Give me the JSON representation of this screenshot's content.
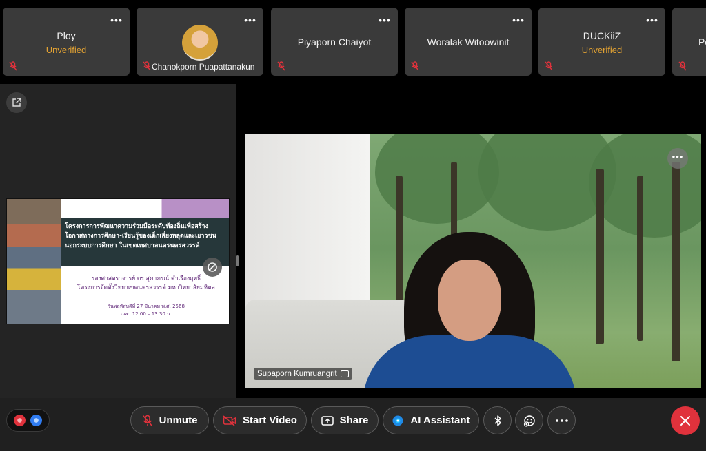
{
  "participants": [
    {
      "name": "Ploy",
      "status": "Unverified"
    },
    {
      "name": "Chanokporn Puapattanakun"
    },
    {
      "name": "Piyaporn Chaiyot"
    },
    {
      "name": "Woralak Witoowinit"
    },
    {
      "name": "DUCKiiZ",
      "status": "Unverified"
    },
    {
      "name": "Po"
    }
  ],
  "slide": {
    "title_lines": [
      "โครงการการพัฒนาความร่วมมือระดับท้องถิ่นเพื่อสร้าง",
      "โอกาสทางการศึกษา-เรียนรู้ของเด็กเสี่ยงหลุดและเยาวชน",
      "นอกระบบการศึกษา ในเขตเทศบาลนครนครสวรรค์"
    ],
    "author_lines": [
      "รองศาสตราจารย์ ดร.สุภาภรณ์ คำเรืองฤทธิ์",
      "โครงการจัดตั้งวิทยาเขตนครสวรรค์ มหาวิทยาลัยมหิดล"
    ],
    "date_lines": [
      "วันพฤหัสบดีที่ 27 มีนาคม พ.ศ. 2568",
      "เวลา 12.00 – 13.30 น."
    ]
  },
  "main_video": {
    "speaker_name": "Supaporn Kumruangrit"
  },
  "toolbar": {
    "unmute_label": "Unmute",
    "start_video_label": "Start Video",
    "share_label": "Share",
    "ai_assistant_label": "AI Assistant"
  },
  "icons": {
    "muted_mic": "mic-off-icon",
    "video_off": "video-off-icon",
    "share": "share-screen-icon",
    "ai": "ai-assistant-icon",
    "bluetooth": "bluetooth-icon",
    "reactions": "reactions-icon",
    "more": "more-icon",
    "end": "close-icon",
    "popout": "popout-icon"
  },
  "colors": {
    "unverified": "#e2a233",
    "muted_red": "#e0323c",
    "end_call": "#e0323c",
    "toolbar_bg": "#202020",
    "tile_bg": "#3a3a3a"
  }
}
